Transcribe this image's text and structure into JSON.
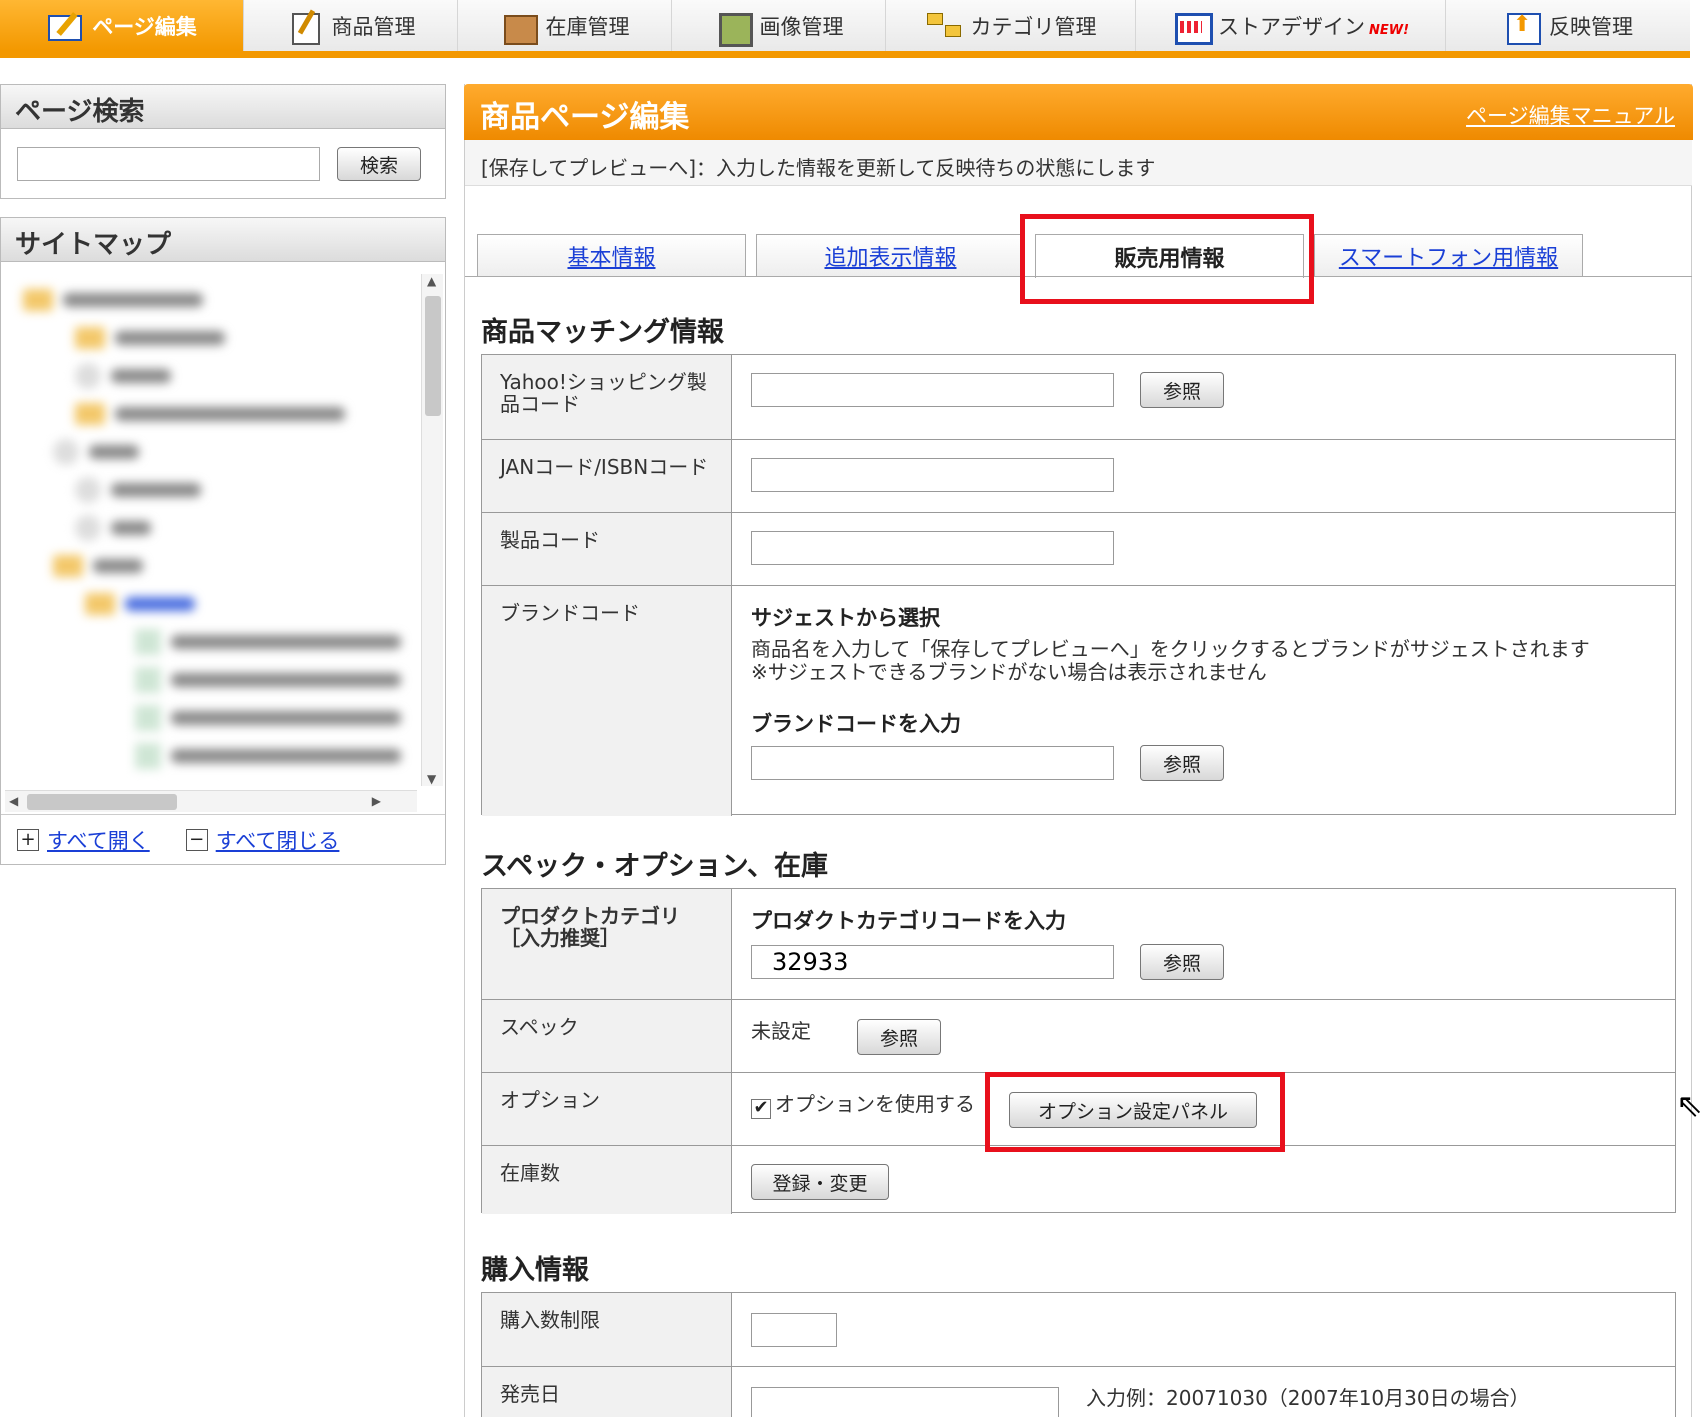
{
  "nav": {
    "tabs": [
      {
        "label": "ページ編集",
        "icon": "page-edit-icon",
        "active": true
      },
      {
        "label": "商品管理",
        "icon": "product-icon"
      },
      {
        "label": "在庫管理",
        "icon": "stock-box-icon"
      },
      {
        "label": "画像管理",
        "icon": "image-icon"
      },
      {
        "label": "カテゴリ管理",
        "icon": "category-icon"
      },
      {
        "label": "ストアデザイン",
        "icon": "store-design-icon",
        "badge": "NEW!"
      },
      {
        "label": "反映管理",
        "icon": "reflect-icon"
      }
    ],
    "accent": "#f39800"
  },
  "search": {
    "title": "ページ検索",
    "value": "",
    "button": "検索"
  },
  "sitemap": {
    "title": "サイトマップ",
    "expand_all": "すべて開く",
    "collapse_all": "すべて閉じる"
  },
  "main": {
    "title": "商品ページ編集",
    "manual_link": "ページ編集マニュアル",
    "notice": "[保存してプレビューへ]：入力した情報を更新して反映待ちの状態にします",
    "tabs": [
      {
        "label": "基本情報"
      },
      {
        "label": "追加表示情報"
      },
      {
        "label": "販売用情報",
        "active": true
      },
      {
        "label": "スマートフォン用情報"
      }
    ]
  },
  "matching": {
    "title": "商品マッチング情報",
    "yahoo_label": "Yahoo!ショッピング製品コード",
    "jan_label": "JANコード/ISBNコード",
    "product_code_label": "製品コード",
    "brand_label": "ブランドコード",
    "brand_suggest_title": "サジェストから選択",
    "brand_suggest_note1": "商品名を入力して「保存してプレビューへ」をクリックするとブランドがサジェストされます",
    "brand_suggest_note2": "※サジェストできるブランドがない場合は表示されません",
    "brand_input_title": "ブランドコードを入力",
    "browse_button": "参照"
  },
  "spec": {
    "title": "スペック・オプション、在庫",
    "category_label": "プロダクトカテゴリ［入力推奨］",
    "category_input_title": "プロダクトカテゴリコードを入力",
    "category_value": "32933",
    "spec_label": "スペック",
    "spec_value": "未設定",
    "option_label": "オプション",
    "option_checkbox": "オプションを使用する",
    "option_checked": true,
    "option_panel_button": "オプション設定パネル",
    "stock_label": "在庫数",
    "stock_button": "登録・変更",
    "browse_button": "参照"
  },
  "purchase": {
    "title": "購入情報",
    "limit_label": "購入数制限",
    "release_label": "発売日",
    "release_example": "入力例：20071030（2007年10月30日の場合）"
  },
  "highlight_color": "#e8101c"
}
